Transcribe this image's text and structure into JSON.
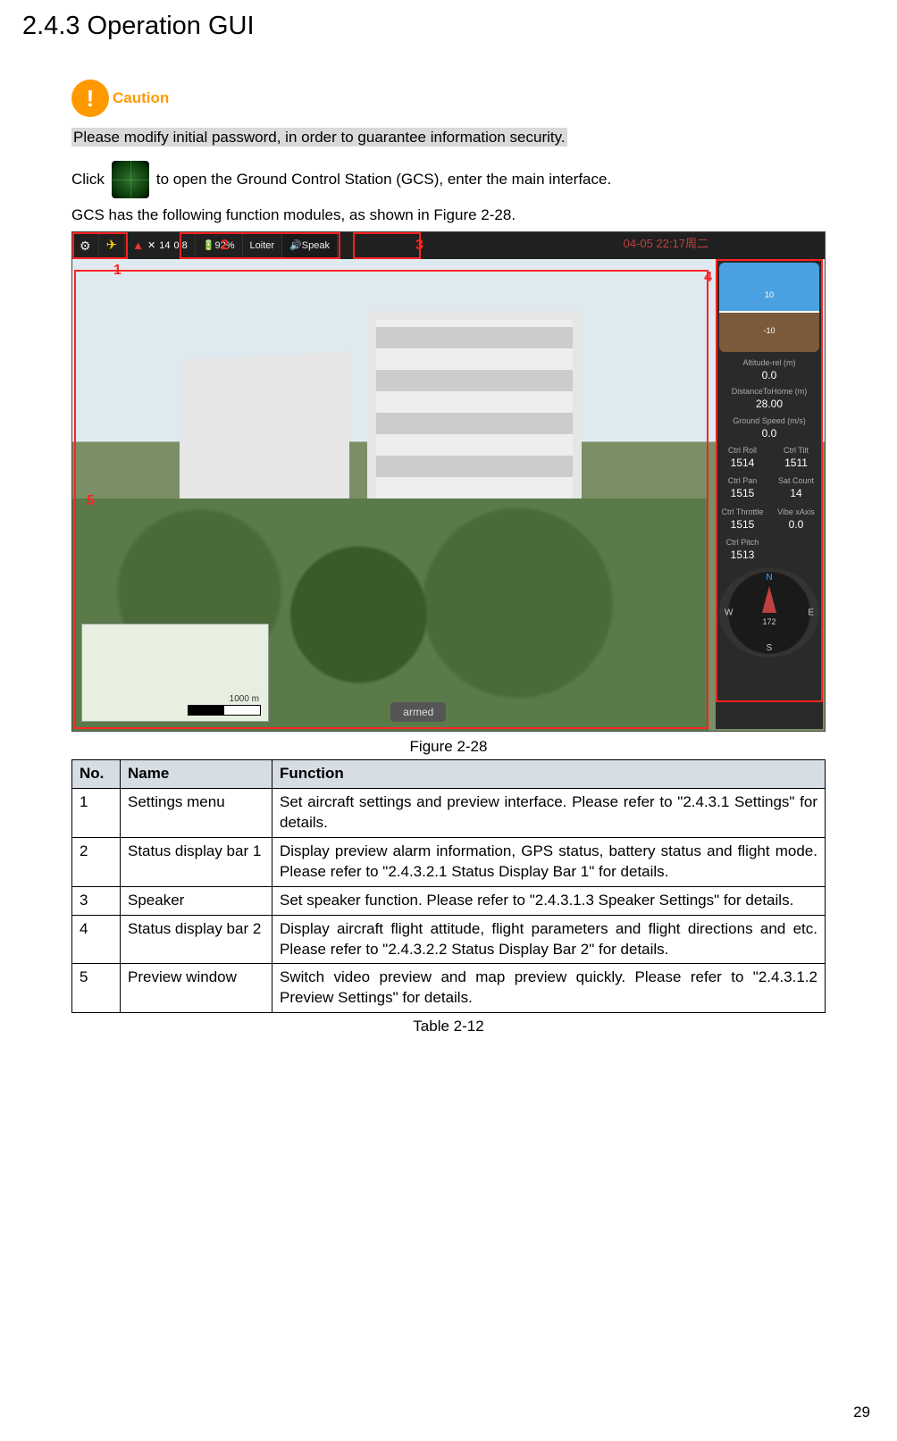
{
  "heading": "2.4.3   Operation GUI",
  "caution_label": "Caution",
  "caution_text": "Please modify initial password, in order to guarantee information security.",
  "click_pre": "Click",
  "click_post": "  to open the Ground Control Station (GCS), enter the main interface.",
  "gcs_line": "GCS has the following function modules, as shown in Figure 2-28.",
  "figure_caption": "Figure 2-28",
  "table_caption": "Table 2-12",
  "page_number": "29",
  "topbar": {
    "sat": "14",
    "hdop": "0.8",
    "battery": "92%",
    "mode": "Loiter",
    "speak": "Speak"
  },
  "overlays": {
    "l1": "1",
    "l2": "2",
    "l3": "3",
    "l4": "4",
    "l5": "5",
    "armed": "armed",
    "datetime": "04-05 22:17周二",
    "map_scale": "1000 m"
  },
  "sidepanel": {
    "att_up": "10",
    "att_dn": "-10",
    "alt_lbl": "Altitude-rel (m)",
    "alt_val": "0.0",
    "dist_lbl": "DistanceToHome (m)",
    "dist_val": "28.00",
    "gs_lbl": "Ground Speed (m/s)",
    "gs_val": "0.0",
    "ctrl_roll_lbl": "Ctrl Roll",
    "ctrl_roll_val": "1514",
    "ctrl_tilt_lbl": "Ctrl Tilt",
    "ctrl_tilt_val": "1511",
    "ctrl_pan_lbl": "Ctrl Pan",
    "ctrl_pan_val": "1515",
    "sat_count_lbl": "Sat Count",
    "sat_count_val": "14",
    "ctrl_throttle_lbl": "Ctrl Throttle",
    "ctrl_throttle_val": "1515",
    "vibe_lbl": "Vibe xAxis",
    "vibe_val": "0.0",
    "ctrl_pitch_lbl": "Ctrl Pitch",
    "ctrl_pitch_val": "1513",
    "compass_n": "N",
    "compass_s": "S",
    "compass_e": "E",
    "compass_w": "W",
    "compass_deg": "172"
  },
  "table": {
    "headers": {
      "no": "No.",
      "name": "Name",
      "func": "Function"
    },
    "rows": [
      {
        "no": "1",
        "name": "Settings menu",
        "func": "Set aircraft settings and preview interface. Please refer to \"2.4.3.1 Settings\" for details."
      },
      {
        "no": "2",
        "name": "Status display bar 1",
        "func": "Display preview alarm information, GPS status, battery status and flight mode. Please refer to \"2.4.3.2.1 Status Display Bar 1\" for details."
      },
      {
        "no": "3",
        "name": "Speaker",
        "func": "Set speaker function. Please refer to \"2.4.3.1.3 Speaker Settings\" for details."
      },
      {
        "no": "4",
        "name": "Status display bar 2",
        "func": "Display aircraft flight attitude, flight parameters and flight directions and etc. Please refer to \"2.4.3.2.2 Status Display Bar 2\" for details."
      },
      {
        "no": "5",
        "name": "Preview window",
        "func": "Switch video preview and map preview quickly. Please refer to \"2.4.3.1.2 Preview Settings\" for details."
      }
    ]
  }
}
